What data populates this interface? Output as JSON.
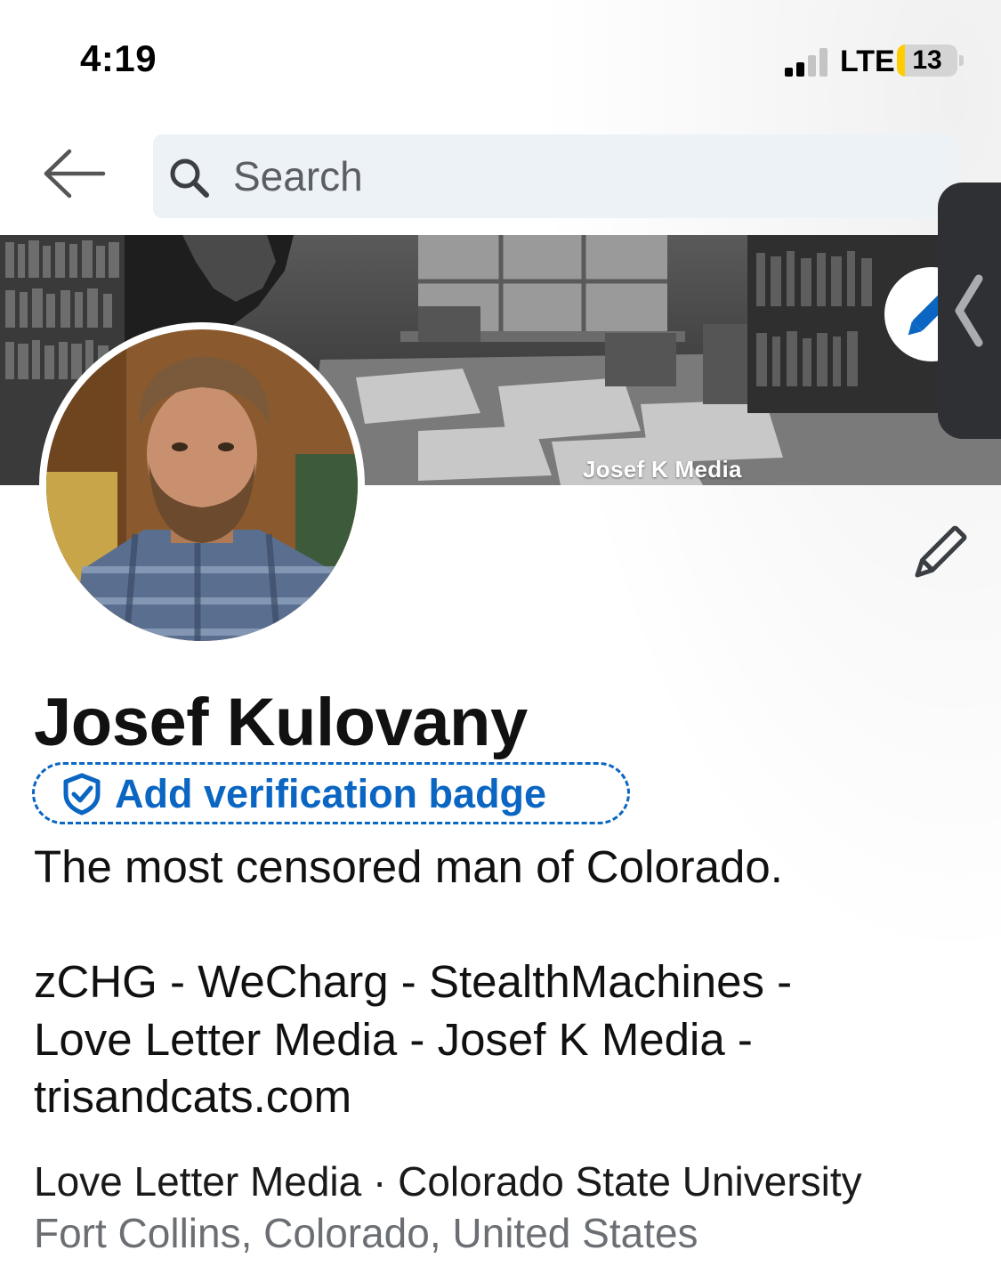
{
  "status_bar": {
    "time": "4:19",
    "network": "LTE",
    "battery_level": "13",
    "battery_fraction": 0.13,
    "signal_bars_active": 2,
    "signal_bars_total": 4
  },
  "nav": {
    "back_icon": "arrow-left-icon",
    "search": {
      "icon": "search-icon",
      "placeholder": "Search"
    }
  },
  "cover": {
    "watermark": "Josef K Media",
    "edit_icon": "pencil-icon"
  },
  "side_handle": {
    "icon": "chevron-left-icon"
  },
  "profile": {
    "edit_icon": "pencil-icon",
    "name": "Josef Kulovany",
    "verification": {
      "icon": "shield-check-icon",
      "label": "Add verification badge"
    },
    "headline": "The most censored man of Colorado.\n\nzCHG - WeCharg - StealthMachines -\nLove Letter Media - Josef K Media -\ntrisandcats.com",
    "company_line": "Love Letter Media · Colorado State University",
    "location": "Fort Collins, Colorado, United States"
  },
  "colors": {
    "accent": "#0a66c2",
    "search_bg": "#edf2f7",
    "battery_fill": "#ffcc00",
    "handle_bg": "#2e3033",
    "secondary_text": "#6b6f73"
  }
}
